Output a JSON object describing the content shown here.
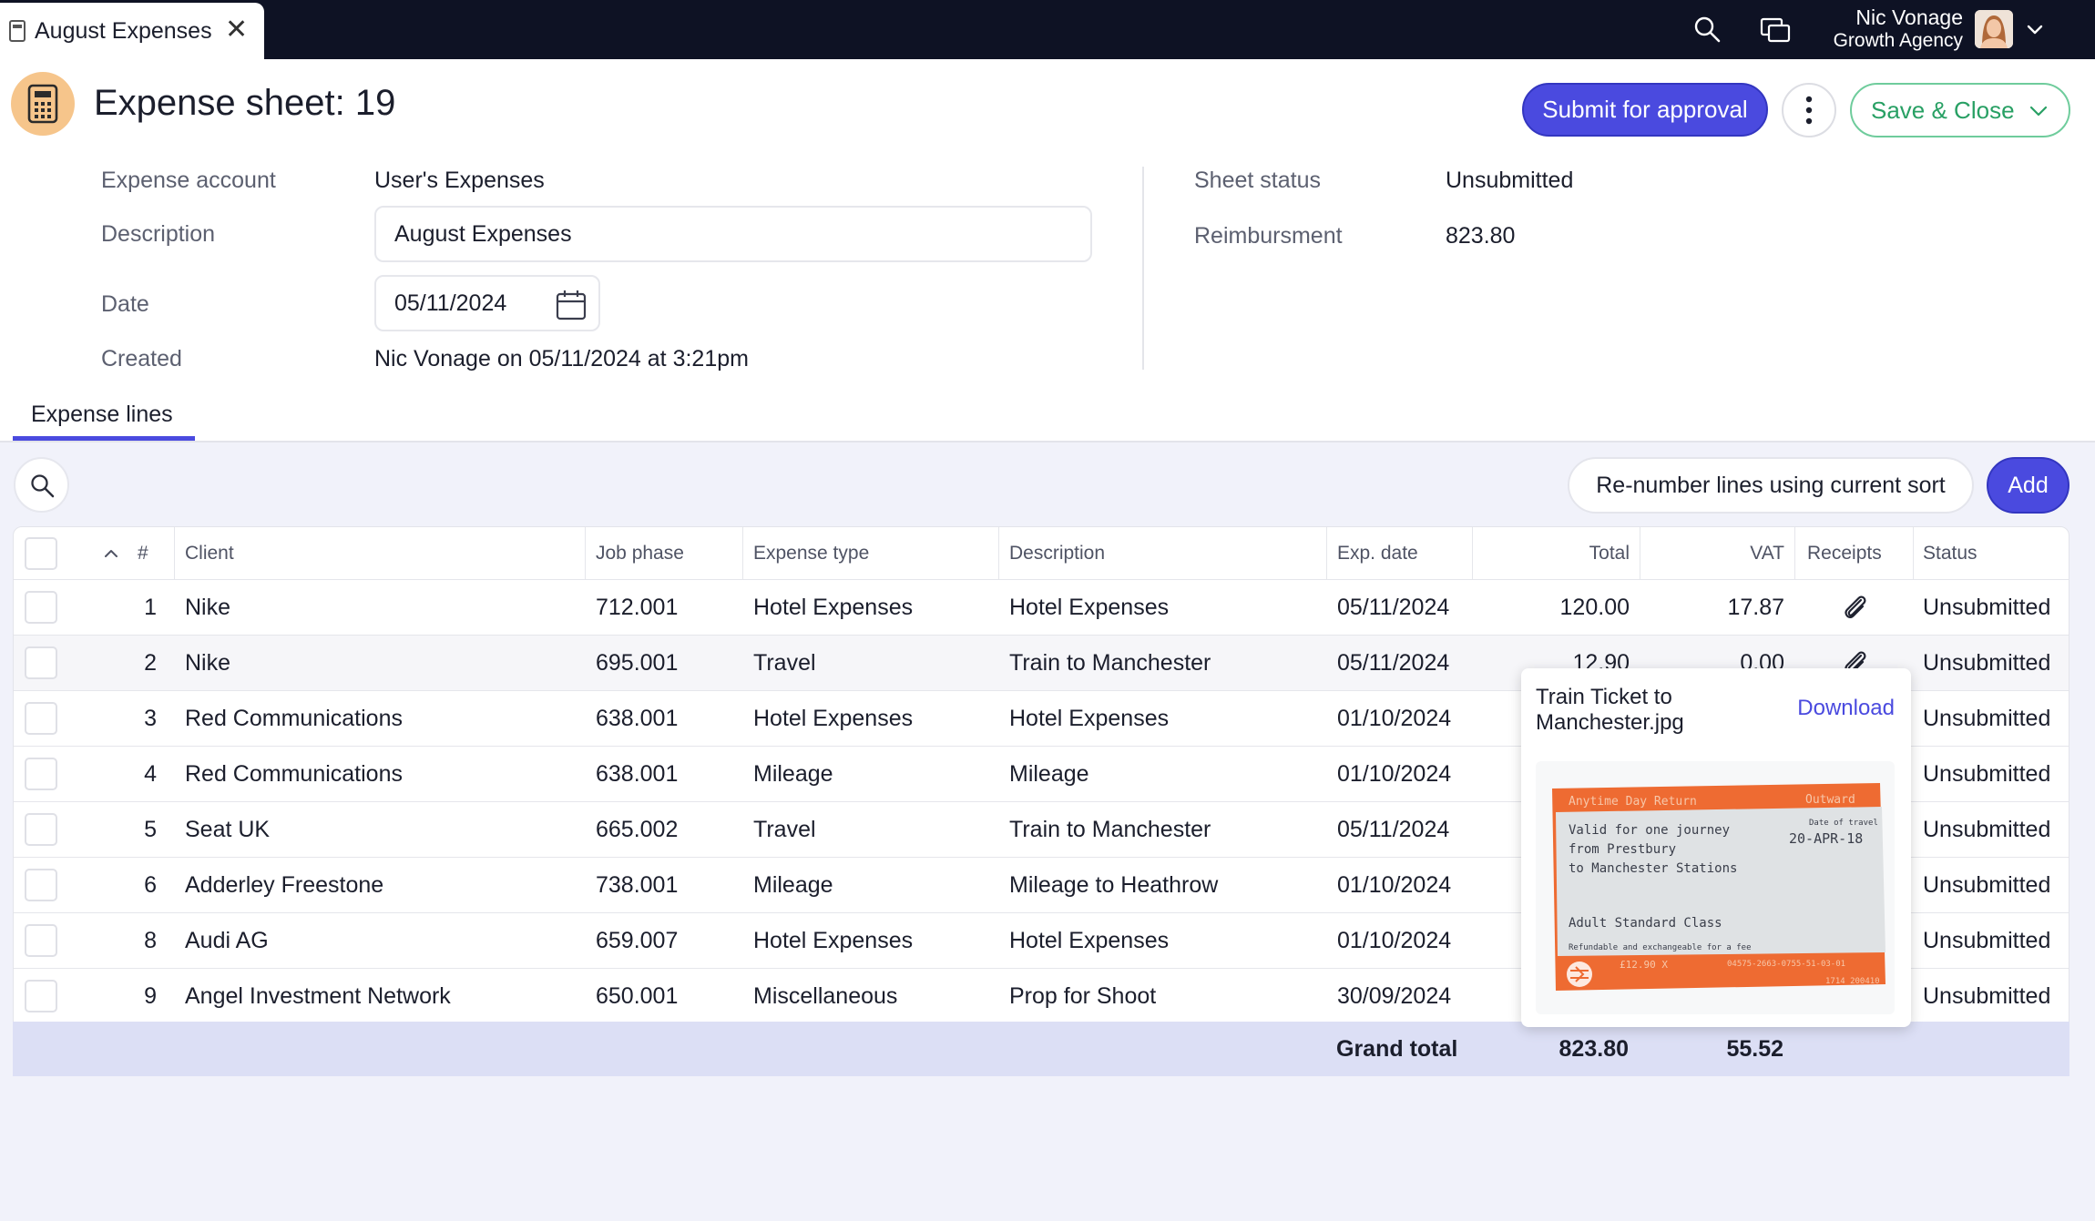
{
  "topbar": {
    "tab_label": "August Expenses",
    "tab_close": "✕",
    "user_name": "Nic Vonage",
    "user_org": "Growth Agency"
  },
  "header": {
    "title": "Expense sheet: 19",
    "submit_label": "Submit for approval",
    "save_close_label": "Save & Close"
  },
  "form": {
    "expense_account_label": "Expense account",
    "expense_account_value": "User's Expenses",
    "description_label": "Description",
    "description_value": "August Expenses",
    "date_label": "Date",
    "date_value": "05/11/2024",
    "created_label": "Created",
    "created_value": "Nic Vonage on 05/11/2024 at 3:21pm",
    "sheet_status_label": "Sheet status",
    "sheet_status_value": "Unsubmitted",
    "reimbursement_label": "Reimbursment",
    "reimbursement_value": "823.80"
  },
  "tabs": {
    "expense_lines": "Expense lines"
  },
  "toolbar": {
    "renumber_label": "Re-number lines using current sort",
    "add_label": "Add"
  },
  "table": {
    "headers": {
      "num": "#",
      "client": "Client",
      "job_phase": "Job phase",
      "expense_type": "Expense type",
      "description": "Description",
      "exp_date": "Exp. date",
      "total": "Total",
      "vat": "VAT",
      "receipts": "Receipts",
      "status": "Status"
    },
    "rows": [
      {
        "num": "1",
        "client": "Nike",
        "job_phase": "712.001",
        "expense_type": "Hotel Expenses",
        "description": "Hotel Expenses",
        "exp_date": "05/11/2024",
        "total": "120.00",
        "vat": "17.87",
        "status": "Unsubmitted"
      },
      {
        "num": "2",
        "client": "Nike",
        "job_phase": "695.001",
        "expense_type": "Travel",
        "description": "Train to Manchester",
        "exp_date": "05/11/2024",
        "total": "12.90",
        "vat": "0.00",
        "status": "Unsubmitted"
      },
      {
        "num": "3",
        "client": "Red Communications",
        "job_phase": "638.001",
        "expense_type": "Hotel Expenses",
        "description": "Hotel Expenses",
        "exp_date": "01/10/2024",
        "total": "",
        "vat": "",
        "status": "Unsubmitted"
      },
      {
        "num": "4",
        "client": "Red Communications",
        "job_phase": "638.001",
        "expense_type": "Mileage",
        "description": "Mileage",
        "exp_date": "01/10/2024",
        "total": "",
        "vat": "",
        "status": "Unsubmitted"
      },
      {
        "num": "5",
        "client": "Seat UK",
        "job_phase": "665.002",
        "expense_type": "Travel",
        "description": "Train to Manchester",
        "exp_date": "05/11/2024",
        "total": "",
        "vat": "",
        "status": "Unsubmitted"
      },
      {
        "num": "6",
        "client": "Adderley Freestone",
        "job_phase": "738.001",
        "expense_type": "Mileage",
        "description": "Mileage to Heathrow",
        "exp_date": "01/10/2024",
        "total": "",
        "vat": "",
        "status": "Unsubmitted"
      },
      {
        "num": "8",
        "client": "Audi AG",
        "job_phase": "659.007",
        "expense_type": "Hotel Expenses",
        "description": "Hotel Expenses",
        "exp_date": "01/10/2024",
        "total": "",
        "vat": "",
        "status": "Unsubmitted"
      },
      {
        "num": "9",
        "client": "Angel Investment Network",
        "job_phase": "650.001",
        "expense_type": "Miscellaneous",
        "description": "Prop for Shoot",
        "exp_date": "30/09/2024",
        "total": "",
        "vat": "",
        "status": "Unsubmitted"
      }
    ],
    "grand_total_label": "Grand total",
    "grand_total": "823.80",
    "grand_vat": "55.52"
  },
  "popup": {
    "title": "Train Ticket to Manchester.jpg",
    "download_label": "Download",
    "ticket": {
      "header_left": "Anytime Day Return",
      "header_right": "Outward",
      "line1": "Valid for one journey",
      "line2": "from  Prestbury",
      "line3": "to     Manchester Stations",
      "date_caption": "Date of travel",
      "date": "20-APR-18",
      "ticket_class": "Adult Standard Class",
      "refund_note": "Refundable and exchangeable for a fee",
      "price": "£12.90  X",
      "code": "04575-2663-0755-51-03-01",
      "code2": "1714 200410"
    }
  },
  "icons": {
    "tab": "document-icon",
    "search": "search-icon",
    "windows": "windows-icon",
    "chevron": "chevron-down-icon",
    "calendar": "calendar-icon",
    "more": "more-vertical-icon",
    "receipt": "paperclip-icon",
    "sort": "sort-ascending-icon",
    "app": "calculator-icon"
  },
  "colors": {
    "topbar": "#0e1224",
    "accent": "#4a4adf",
    "save_green": "#28a064",
    "app_icon_bg": "#f6c58b",
    "grand_total_bg": "#dcdff5",
    "grid_bg": "#f1f2fa"
  }
}
